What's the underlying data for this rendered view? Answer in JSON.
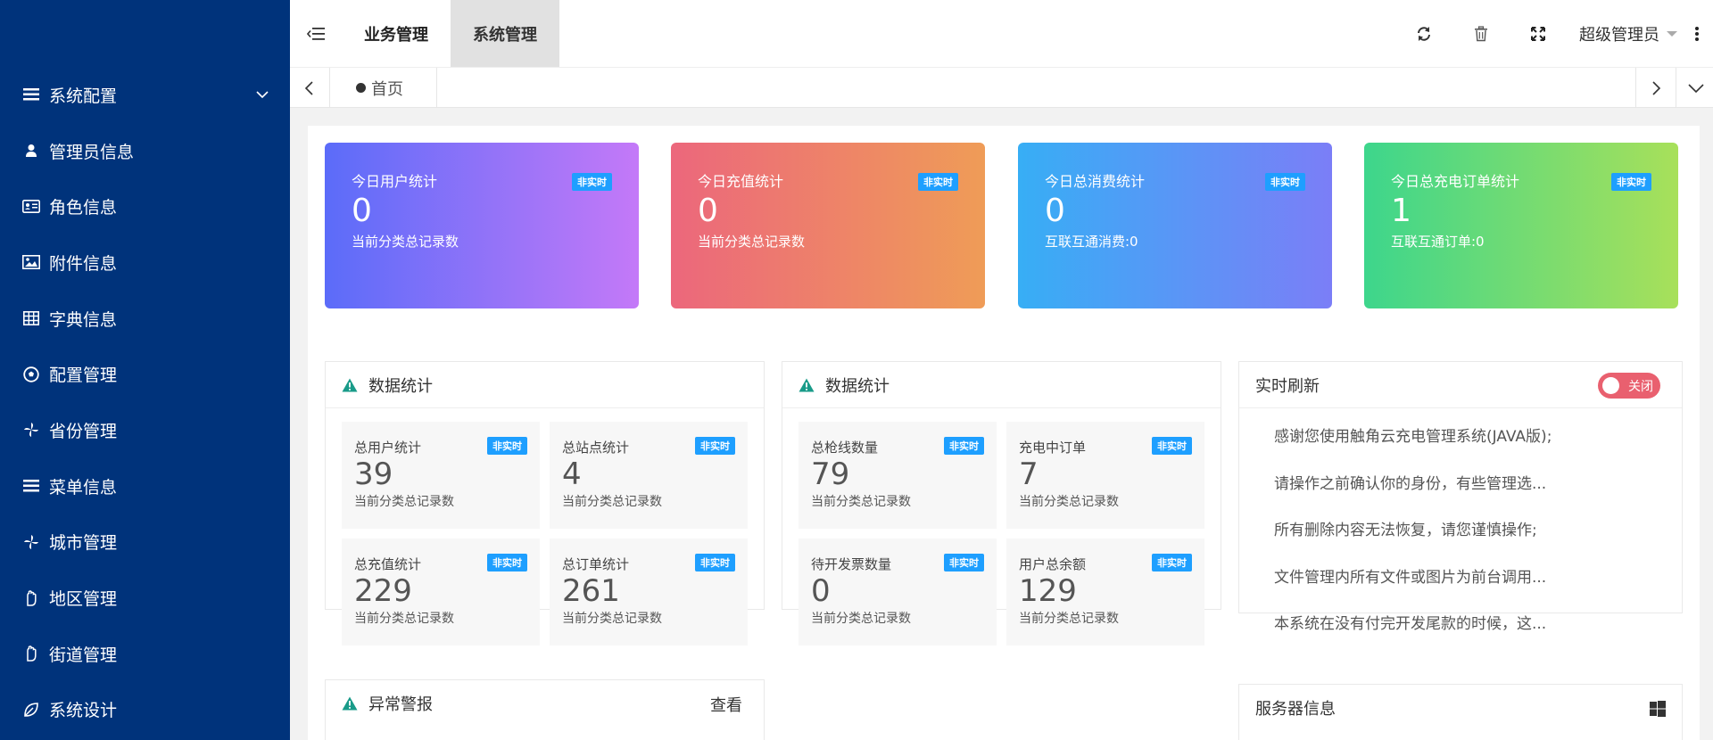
{
  "sidebar": {
    "items": [
      {
        "label": "系统配置",
        "icon": "list-icon",
        "expandable": true
      },
      {
        "label": "管理员信息",
        "icon": "user-icon"
      },
      {
        "label": "角色信息",
        "icon": "id-card-icon"
      },
      {
        "label": "附件信息",
        "icon": "image-icon"
      },
      {
        "label": "字典信息",
        "icon": "table-icon"
      },
      {
        "label": "配置管理",
        "icon": "soccer-ball-icon"
      },
      {
        "label": "省份管理",
        "icon": "pinwheel-icon"
      },
      {
        "label": "菜单信息",
        "icon": "list-icon"
      },
      {
        "label": "城市管理",
        "icon": "pinwheel-icon"
      },
      {
        "label": "地区管理",
        "icon": "hand-icon"
      },
      {
        "label": "街道管理",
        "icon": "hand-icon"
      },
      {
        "label": "系统设计",
        "icon": "leaf-icon"
      }
    ]
  },
  "header": {
    "tabs": [
      "业务管理",
      "系统管理"
    ],
    "active_tab": "系统管理",
    "user_name": "超级管理员"
  },
  "tabbar": {
    "home_label": "首页"
  },
  "stat_cards": [
    {
      "title": "今日用户统计",
      "badge": "非实时",
      "value": "0",
      "sub": "当前分类总记录数",
      "gradient": [
        "#5b6cf9",
        "#c479f8"
      ]
    },
    {
      "title": "今日充值统计",
      "badge": "非实时",
      "value": "0",
      "sub": "当前分类总记录数",
      "gradient": [
        "#ec677c",
        "#ef9c57"
      ]
    },
    {
      "title": "今日总消费统计",
      "badge": "非实时",
      "value": "0",
      "sub": "互联互通消费:0",
      "gradient": [
        "#37aef5",
        "#7b7ef7"
      ]
    },
    {
      "title": "今日总充电订单统计",
      "badge": "非实时",
      "value": "1",
      "sub": "互联互通订单:0",
      "gradient": [
        "#3dd68c",
        "#a8e05a"
      ]
    }
  ],
  "stats_panel_1": {
    "title": "数据统计",
    "cells": [
      {
        "title": "总用户统计",
        "badge": "非实时",
        "value": "39",
        "sub": "当前分类总记录数"
      },
      {
        "title": "总站点统计",
        "badge": "非实时",
        "value": "4",
        "sub": "当前分类总记录数"
      },
      {
        "title": "总充值统计",
        "badge": "非实时",
        "value": "229",
        "sub": "当前分类总记录数"
      },
      {
        "title": "总订单统计",
        "badge": "非实时",
        "value": "261",
        "sub": "当前分类总记录数"
      }
    ]
  },
  "stats_panel_2": {
    "title": "数据统计",
    "cells": [
      {
        "title": "总枪线数量",
        "badge": "非实时",
        "value": "79",
        "sub": "当前分类总记录数"
      },
      {
        "title": "充电中订单",
        "badge": "非实时",
        "value": "7",
        "sub": "当前分类总记录数"
      },
      {
        "title": "待开发票数量",
        "badge": "非实时",
        "value": "0",
        "sub": "当前分类总记录数"
      },
      {
        "title": "用户总余额",
        "badge": "非实时",
        "value": "129",
        "sub": "当前分类总记录数"
      }
    ]
  },
  "realtime_panel": {
    "title": "实时刷新",
    "switch_label": "关闭",
    "notices": [
      "感谢您使用触角云充电管理系统(JAVA版);",
      "请操作之前确认你的身份，有些管理选...",
      "所有删除内容无法恢复，请您谨慎操作;",
      "文件管理内所有文件或图片为前台调用...",
      "本系统在没有付完开发尾款的时候，这..."
    ]
  },
  "alarm_panel": {
    "title": "异常警报",
    "link": "查看"
  },
  "server_panel": {
    "title": "服务器信息"
  },
  "colors": {
    "sidebar_bg": "#00337b",
    "badge": "#1e9fff",
    "warn_icon": "#199b89",
    "switch_off": "#e9606f"
  }
}
